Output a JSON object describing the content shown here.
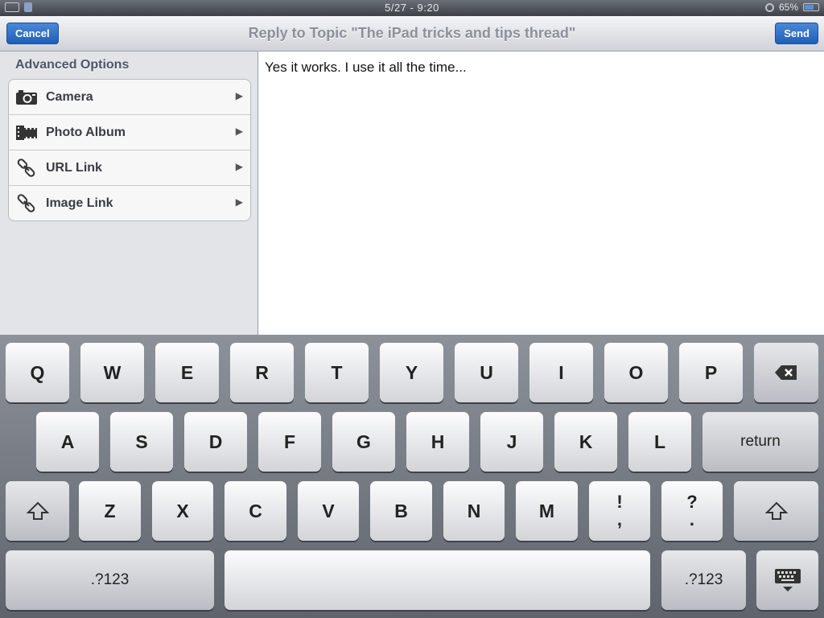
{
  "status": {
    "time": "5/27 - 9:20",
    "battery": "65%"
  },
  "nav": {
    "cancel_label": "Cancel",
    "title": "Reply to Topic \"The iPad tricks and tips thread\"",
    "send_label": "Send"
  },
  "options": {
    "header": "Advanced Options",
    "items": [
      {
        "label": "Camera",
        "icon": "camera-icon"
      },
      {
        "label": "Photo Album",
        "icon": "film-icon"
      },
      {
        "label": "URL Link",
        "icon": "link-icon"
      },
      {
        "label": "Image Link",
        "icon": "link-icon"
      }
    ]
  },
  "compose": {
    "text": "Yes it works. I use it all the time..."
  },
  "keyboard": {
    "row1": [
      "Q",
      "W",
      "E",
      "R",
      "T",
      "Y",
      "U",
      "I",
      "O",
      "P"
    ],
    "row2": [
      "A",
      "S",
      "D",
      "F",
      "G",
      "H",
      "J",
      "K",
      "L"
    ],
    "row3": [
      "Z",
      "X",
      "C",
      "V",
      "B",
      "N",
      "M"
    ],
    "return_label": "return",
    "numbers_label": ".?123",
    "punct1_top": "!",
    "punct1_bottom": ",",
    "punct2_top": "?",
    "punct2_bottom": "."
  }
}
